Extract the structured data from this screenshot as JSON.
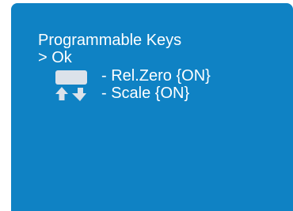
{
  "screen": {
    "background_color": "#0f82c4",
    "text_color": "#ffffff",
    "title": "Programmable Keys",
    "selected_item": "> Ok",
    "key_assignments": [
      {
        "icon": "blank-key-icon",
        "label": "- Rel.Zero {ON}"
      },
      {
        "icon": "up-down-arrows-icon",
        "label": "- Scale {ON}"
      }
    ]
  }
}
